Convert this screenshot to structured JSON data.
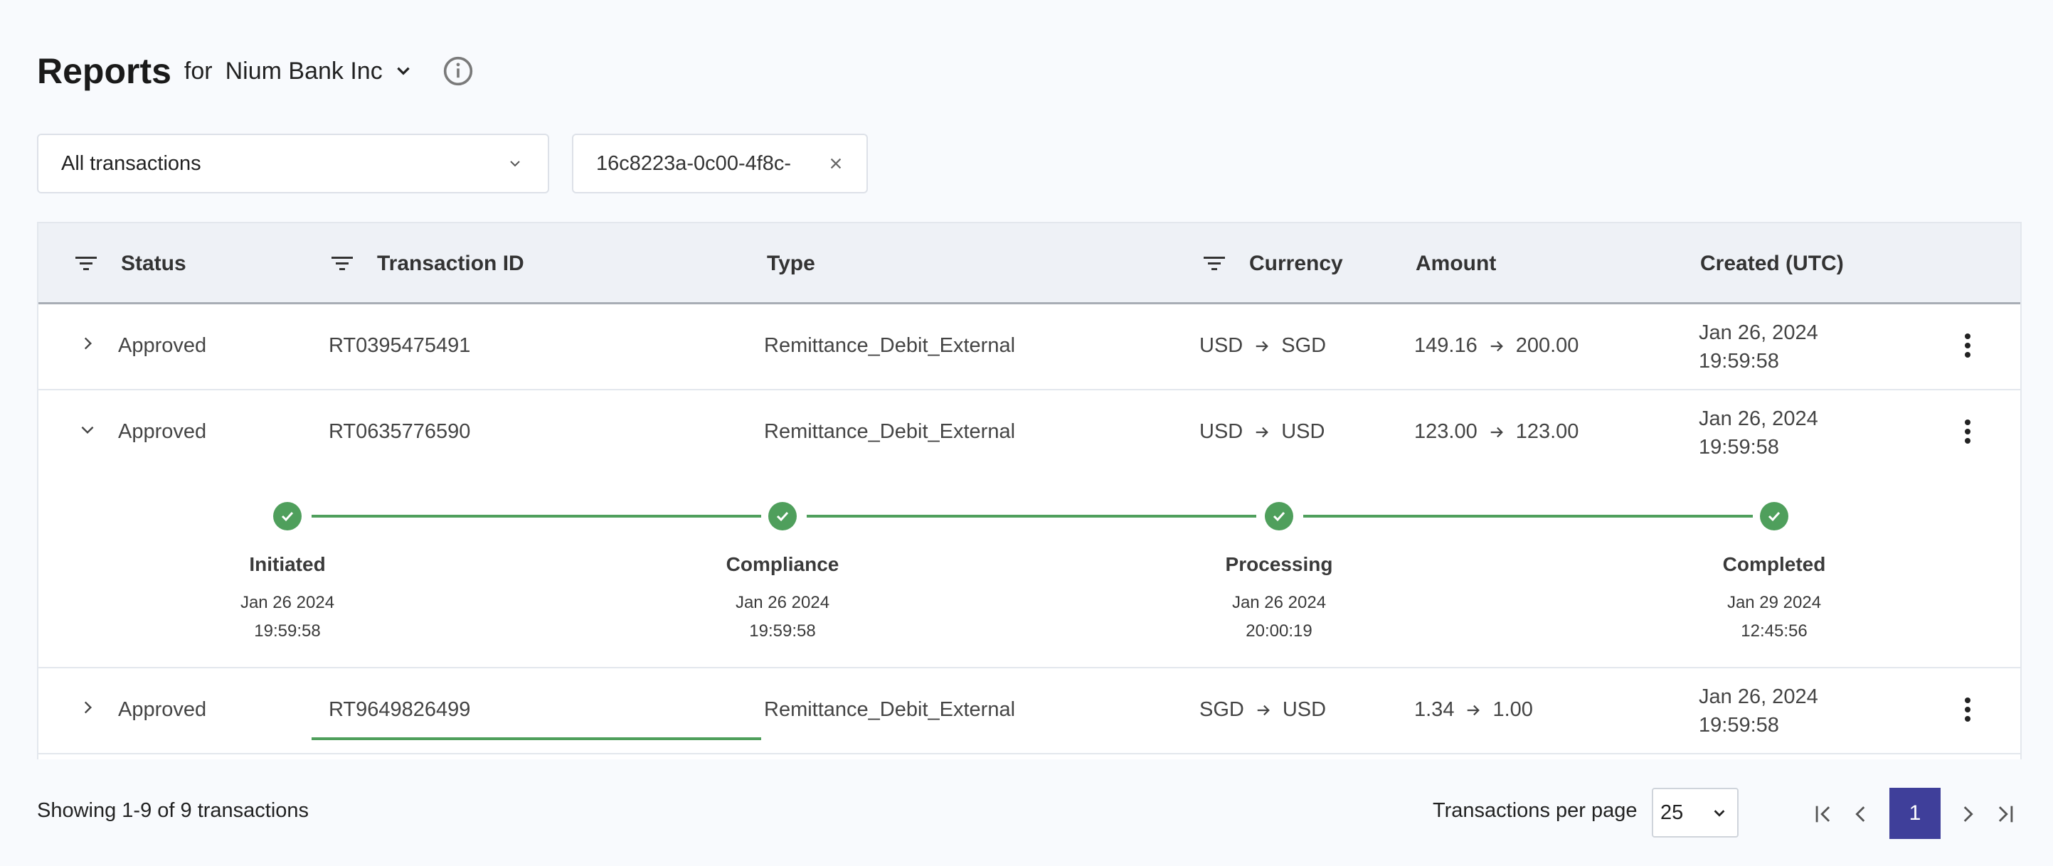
{
  "header": {
    "title": "Reports",
    "for_label": "for",
    "entity": "Nium Bank Inc"
  },
  "filters": {
    "type_select": "All transactions",
    "search_chip": "16c8223a-0c00-4f8c-"
  },
  "table": {
    "columns": {
      "status": "Status",
      "transaction_id": "Transaction ID",
      "type": "Type",
      "currency": "Currency",
      "amount": "Amount",
      "created": "Created (UTC)"
    },
    "rows": [
      {
        "status": "Approved",
        "id": "RT0395475491",
        "type": "Remittance_Debit_External",
        "cur_from": "USD",
        "cur_to": "SGD",
        "amt_from": "149.16",
        "amt_to": "200.00",
        "date": "Jan 26, 2024",
        "time": "19:59:58"
      },
      {
        "status": "Approved",
        "id": "RT0635776590",
        "type": "Remittance_Debit_External",
        "cur_from": "USD",
        "cur_to": "USD",
        "amt_from": "123.00",
        "amt_to": "123.00",
        "date": "Jan 26, 2024",
        "time": "19:59:58"
      },
      {
        "status": "Approved",
        "id": "RT9649826499",
        "type": "Remittance_Debit_External",
        "cur_from": "SGD",
        "cur_to": "USD",
        "amt_from": "1.34",
        "amt_to": "1.00",
        "date": "Jan 26, 2024",
        "time": "19:59:58"
      }
    ],
    "timeline": [
      {
        "label": "Initiated",
        "date": "Jan 26 2024",
        "time": "19:59:58"
      },
      {
        "label": "Compliance",
        "date": "Jan 26 2024",
        "time": "19:59:58"
      },
      {
        "label": "Processing",
        "date": "Jan 26 2024",
        "time": "20:00:19"
      },
      {
        "label": "Completed",
        "date": "Jan 29 2024",
        "time": "12:45:56"
      }
    ]
  },
  "footer": {
    "showing": "Showing 1-9 of 9 transactions",
    "per_page_label": "Transactions per page",
    "per_page_value": "25",
    "current_page": "1"
  },
  "colors": {
    "accent": "#3f3f9a",
    "success": "#4f9f5c"
  },
  "icons": {
    "entity_dropdown": "chevron-down-icon",
    "info": "info-icon",
    "chip_close": "close-icon",
    "column_filter": "filter-icon",
    "row_expand": "chevron-right-icon",
    "row_collapse": "chevron-down-icon",
    "row_menu": "kebab-menu-icon",
    "step_done": "check-icon"
  }
}
